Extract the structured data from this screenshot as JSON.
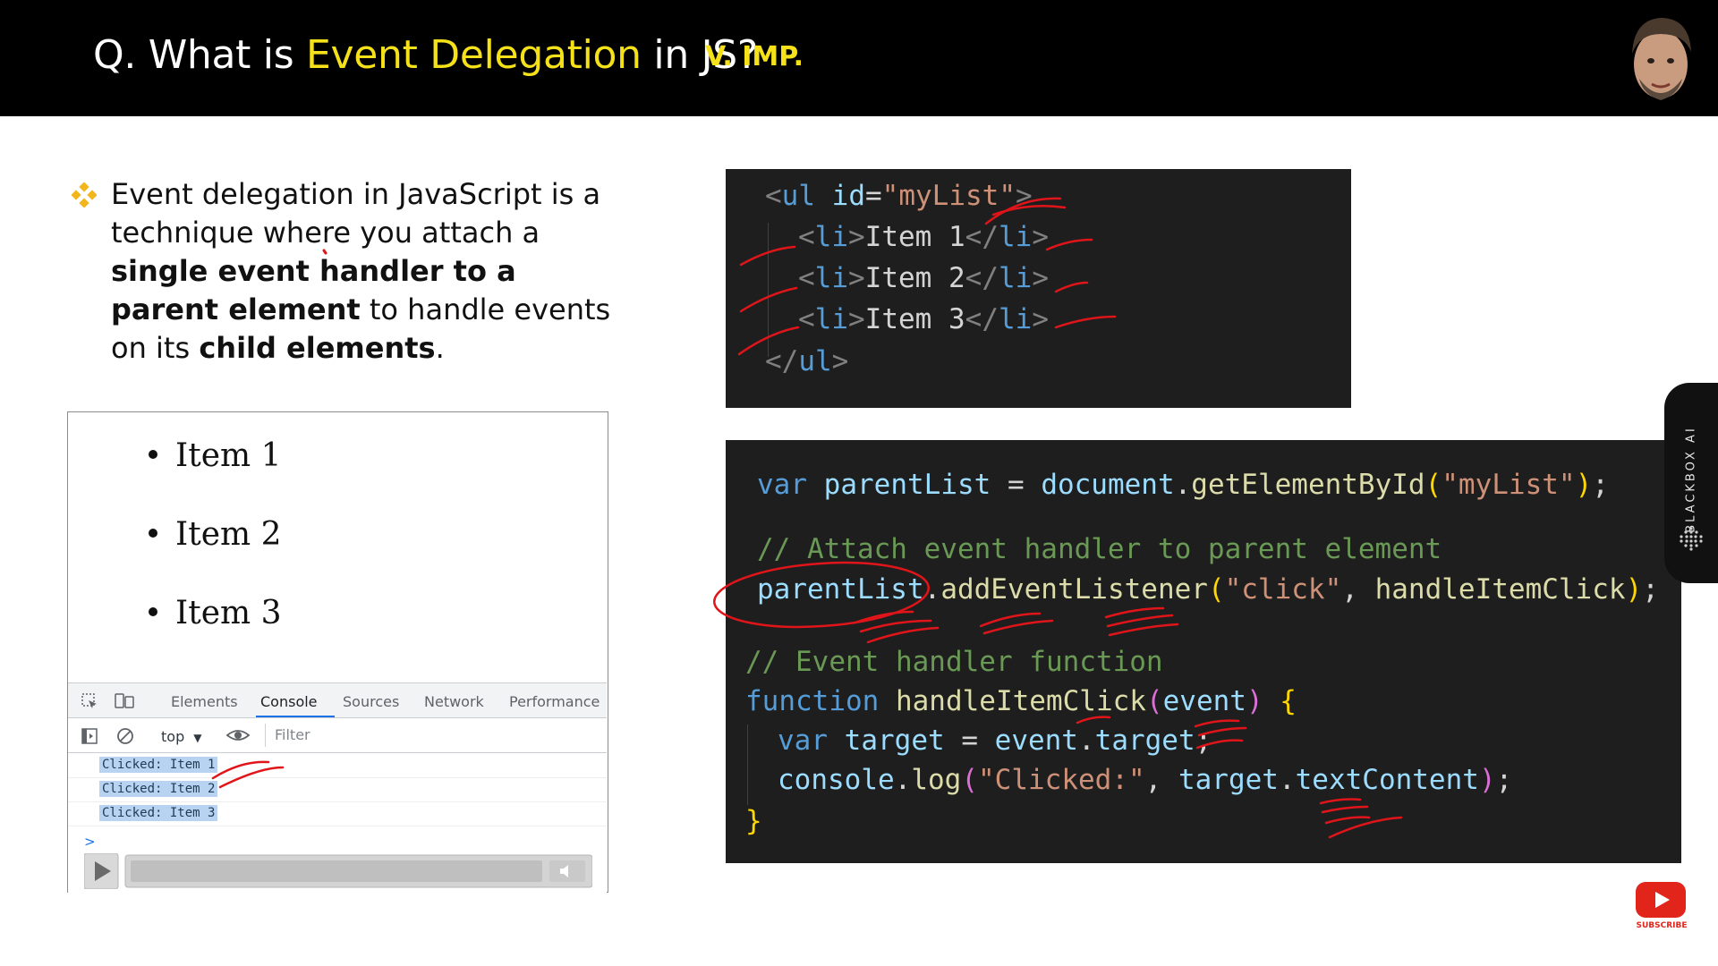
{
  "header": {
    "title_prefix": "Q. What is ",
    "title_highlight": "Event Delegation",
    "title_suffix": " in JS?",
    "badge": "V. IMP."
  },
  "description": {
    "p1": "Event delegation in JavaScript is a technique where you attach a ",
    "b1": "single event handler to a parent element",
    "p2": " to handle events on its ",
    "b2": "child elements",
    "p3": "."
  },
  "demo": {
    "items": [
      "Item 1",
      "Item 2",
      "Item 3"
    ],
    "devtools": {
      "tabs": [
        "Elements",
        "Console",
        "Sources",
        "Network",
        "Performance"
      ],
      "active_tab": "Console",
      "context": "top",
      "filter_placeholder": "Filter",
      "logs": [
        "Clicked: Item 1",
        "Clicked: Item 2",
        "Clicked: Item 3"
      ],
      "prompt": ">"
    }
  },
  "code_html": {
    "list_id": "\"myList\"",
    "item_texts": [
      "Item 1",
      "Item 2",
      "Item 3"
    ]
  },
  "code_js": {
    "var_kw": "var",
    "var_name": "parentList",
    "doc": "document",
    "get_fn": "getElementById",
    "get_arg": "\"myList\"",
    "comment1": "// Attach event handler to parent element",
    "add_fn": "addEventListener",
    "event_str": "\"click\"",
    "handler_name": "handleItemClick",
    "comment2": "// Event handler function",
    "function_kw": "function",
    "param": "event",
    "target_var": "target",
    "target_prop": "target",
    "console_obj": "console",
    "log_fn": "log",
    "log_str": "\"Clicked:\"",
    "text_prop": "textContent"
  },
  "side_widget": {
    "label": "BLACKBOX AI"
  },
  "subscribe": {
    "label": "SUBSCRIBE"
  },
  "colors": {
    "highlight_yellow": "#f5e11a",
    "annotation_red": "#e0151a",
    "code_bg": "#1e1e1e",
    "youtube_red": "#e1251b"
  }
}
